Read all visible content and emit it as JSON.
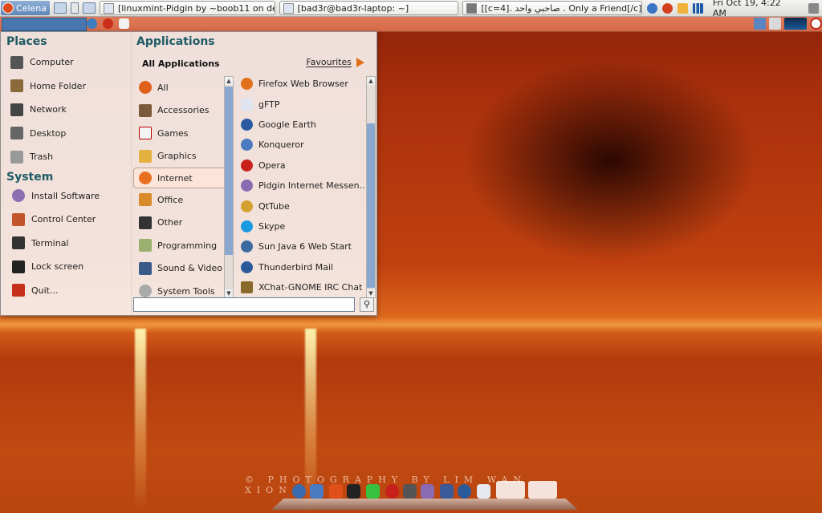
{
  "top_panel": {
    "menu_button_label": "Celena",
    "tasks": [
      "[linuxmint-Pidgin by ~boob11 on de...",
      "[bad3r@bad3r-laptop: ~]",
      "[[c=4]. صاحبي واحد . Only a Friend[/c]]"
    ],
    "clock": "Fri Oct 19,  4:22 AM"
  },
  "menu": {
    "places_title": "Places",
    "places": [
      "Computer",
      "Home Folder",
      "Network",
      "Desktop",
      "Trash"
    ],
    "system_title": "System",
    "system": [
      "Install Software",
      "Control Center",
      "Terminal",
      "Lock screen",
      "Quit..."
    ],
    "applications_title": "Applications",
    "all_applications_label": "All Applications",
    "favourites_label": "Favourites",
    "categories": [
      "All",
      "Accessories",
      "Games",
      "Graphics",
      "Internet",
      "Office",
      "Other",
      "Programming",
      "Sound & Video",
      "System Tools"
    ],
    "selected_category": "Internet",
    "apps": [
      "Firefox Web Browser",
      "gFTP",
      "Google Earth",
      "Konqueror",
      "Opera",
      "Pidgin Internet Messen...",
      "QtTube",
      "Skype",
      "Sun Java 6 Web Start",
      "Thunderbird Mail",
      "XChat-GNOME IRC Chat"
    ],
    "search_value": ""
  },
  "desktop": {
    "watermark": "© PHOTOGRAPHY BY LIM WAN XIONG"
  },
  "colors": {
    "section_title": "#1e5b64",
    "selection_border": "#b9a090",
    "scrollbar_thumb": "#8aa7cf",
    "favourites_arrow": "#e07018"
  }
}
